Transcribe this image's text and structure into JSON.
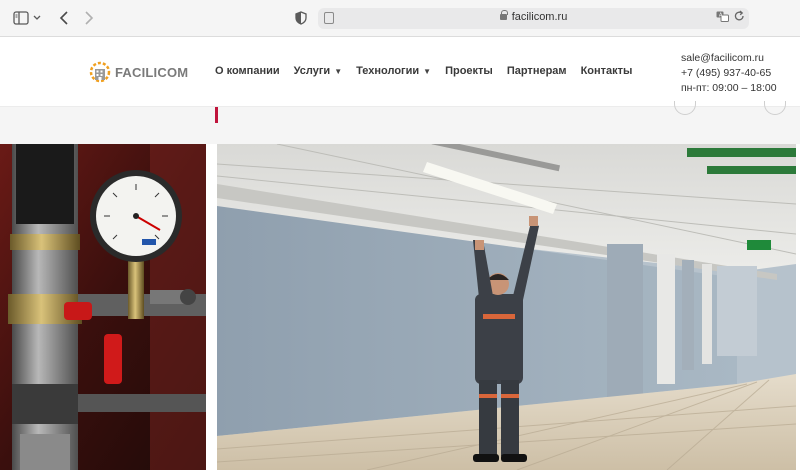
{
  "browser": {
    "url": "facilicom.ru",
    "icons": [
      "sidebar-icon",
      "chevron-down-icon",
      "back-icon",
      "forward-icon",
      "shield-icon",
      "page-icon",
      "lock-icon",
      "translate-icon",
      "reload-icon"
    ]
  },
  "header": {
    "logo_text": "FACILICOM",
    "nav": [
      {
        "label": "О компании",
        "has_dropdown": false
      },
      {
        "label": "Услуги",
        "has_dropdown": true
      },
      {
        "label": "Технологии",
        "has_dropdown": true
      },
      {
        "label": "Проекты",
        "has_dropdown": false
      },
      {
        "label": "Партнерам",
        "has_dropdown": false
      },
      {
        "label": "Контакты",
        "has_dropdown": false
      }
    ],
    "contacts": {
      "email": "sale@facilicom.ru",
      "phone": "+7 (495) 937-40-65",
      "hours": "пн-пт: 09:00 – 18:00"
    }
  },
  "colors": {
    "accent": "#c0143c",
    "logo_orange": "#f0a020",
    "nav_text": "#3a3a3a"
  },
  "images": [
    {
      "name": "pressure-gauge-photo"
    },
    {
      "name": "corridor-worker-photo"
    }
  ]
}
